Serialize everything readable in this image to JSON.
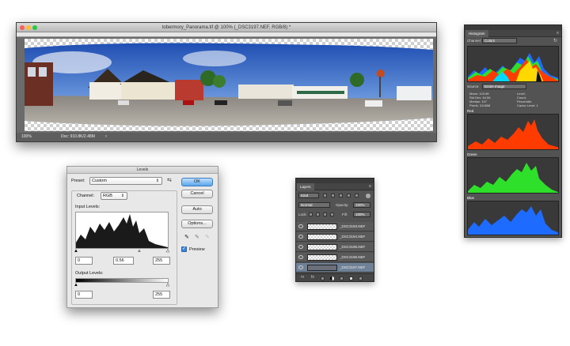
{
  "image_window": {
    "title": "tobermory_Panorama.tif @ 100% (_DSC3197.NEF, RGB/8) *",
    "zoom": "100%",
    "doc_size": "Doc: 910.8K/2.48M"
  },
  "histogram_panel": {
    "tab": "Histogram",
    "channel_label": "Channel:",
    "channel_value": "Colors",
    "source_label": "Source:",
    "source_value": "Entire Image",
    "stats": {
      "mean_label": "Mean:",
      "mean": "103.98",
      "stddev_label": "Std Dev:",
      "stddev": "64.56",
      "median_label": "Median:",
      "median": "107",
      "pixels_label": "Pixels:",
      "pixels": "310898",
      "level_label": "Level:",
      "count_label": "Count:",
      "percentile_label": "Percentile:",
      "cache_label": "Cache Level:",
      "cache": "1"
    },
    "channels": [
      "Red",
      "Green",
      "Blue"
    ],
    "colors": {
      "red": "#ff3b00",
      "green": "#2ee02a",
      "blue": "#1e6bff",
      "yellow": "#ffd800",
      "cyan": "#00d8ff"
    }
  },
  "levels_dialog": {
    "title": "Levels",
    "preset_label": "Preset:",
    "preset_value": "Custom",
    "channel_label": "Channel:",
    "channel_value": "RGB",
    "input_levels_label": "Input Levels:",
    "input_black": "0",
    "input_gamma": "0.56",
    "input_white": "255",
    "output_levels_label": "Output Levels:",
    "output_black": "0",
    "output_white": "255",
    "buttons": {
      "ok": "OK",
      "cancel": "Cancel",
      "auto": "Auto",
      "options": "Options..."
    },
    "preview_label": "Preview"
  },
  "layers_panel": {
    "tab": "Layers",
    "kind": "Kind",
    "blend_mode": "Normal",
    "opacity_label": "Opacity:",
    "opacity": "100%",
    "lock_label": "Lock:",
    "fill_label": "Fill:",
    "fill": "100%",
    "layers": [
      {
        "name": "_DSC3193.NEF"
      },
      {
        "name": "_DSC3194.NEF"
      },
      {
        "name": "_DSC3195.NEF"
      },
      {
        "name": "_DSC3196.NEF"
      },
      {
        "name": "_DSC3197.NEF"
      }
    ]
  }
}
